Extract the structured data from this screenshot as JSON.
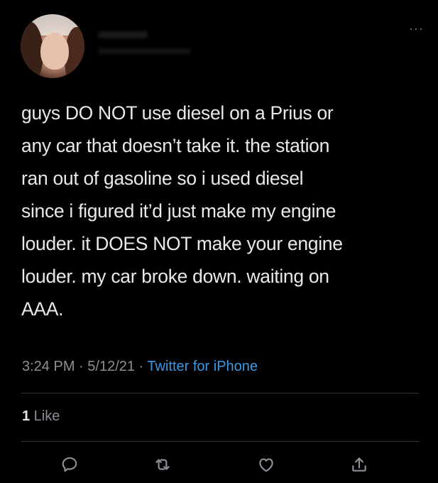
{
  "tweet": {
    "more_label": "···",
    "text": "guys DO NOT use diesel on a Prius or\nany car that doesn’t take it. the station\nran out of gasoline so i used diesel\nsince i figured it’d just make my engine\nlouder. it DOES NOT make your engine\nlouder. my car broke down. waiting on\nAAA.",
    "time": "3:24 PM",
    "sep1": " · ",
    "date": "5/12/21",
    "sep2": " · ",
    "source": "Twitter for iPhone",
    "likes_count": "1",
    "likes_label": " Like"
  },
  "actions": {
    "reply_icon": "reply-icon",
    "retweet_icon": "retweet-icon",
    "like_icon": "heart-icon",
    "share_icon": "share-icon"
  },
  "colors": {
    "background": "#000000",
    "text": "#e7e9ea",
    "muted": "#8b9096",
    "link": "#3a9ae8"
  }
}
